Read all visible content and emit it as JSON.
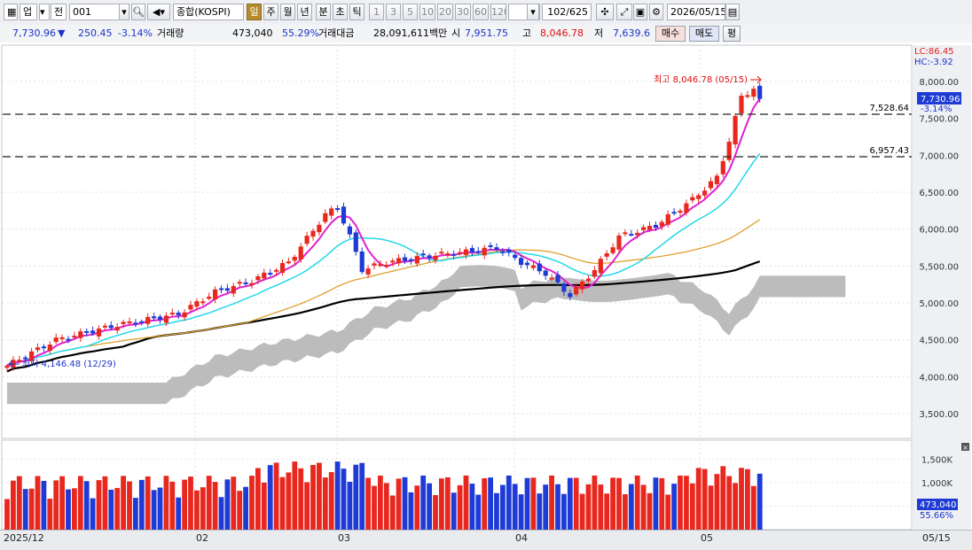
{
  "toolbar": {
    "market_select": "업",
    "prev_label": "전",
    "code_value": "001",
    "search_icon": "search-icon",
    "speaker_icon": "speaker-icon",
    "index_name": "종합(KOSPI)",
    "periods": [
      "일",
      "주",
      "월",
      "년",
      "분",
      "초",
      "틱"
    ],
    "active_period": "일",
    "minute_steps": [
      "1",
      "3",
      "5",
      "10",
      "20",
      "30",
      "60",
      "120"
    ],
    "interval_value": "",
    "count_display": "102/625",
    "date_value": "2026/05/15"
  },
  "info": {
    "price": "7,730.96",
    "change_arrow": "▼",
    "change": "250.45",
    "change_pct": "-3.14%",
    "volume_label": "거래량",
    "volume": "473,040",
    "volume_ratio": "55.29%",
    "amount_label": "거래대금",
    "amount": "28,091,611백만",
    "open_label": "시",
    "open": "7,951.75",
    "high_label": "고",
    "high": "8,046.78",
    "low_label": "저",
    "low": "7,639.6",
    "buy_label": "매수",
    "sell_label": "매도",
    "eval_label": "평"
  },
  "chart": {
    "lc_label": "LC:86.45",
    "hc_label": "HC:-3.92",
    "high_annotation": "최고 8,046.78 (05/15)",
    "low_annotation": "최저 4,146.48 (12/29)",
    "hline_upper": "7,528.64",
    "hline_lower": "6,957.43",
    "current_price_tag": "7,730.96",
    "current_pct_tag": "-3.14%",
    "y_ticks": [
      "8,000.00",
      "7,500.00",
      "7,000.00",
      "6,500.00",
      "6,000.00",
      "5,500.00",
      "5,000.00",
      "4,500.00",
      "4,000.00",
      "3,500.00"
    ],
    "vol_ticks": [
      "1,500K",
      "1,000K",
      "500K"
    ],
    "vol_current_tag": "473,040",
    "vol_pct_tag": "55.66%",
    "x_labels": [
      "2025/12",
      "02",
      "03",
      "04",
      "05"
    ],
    "x_right_label": "05/15",
    "colors": {
      "up": "#e8281e",
      "down": "#1f3bd6",
      "ma5": "#e020d0",
      "ma20": "#22d8e8",
      "ma60": "#e0a030",
      "ma120": "#000000",
      "cloud": "#b8b8b8"
    }
  }
}
